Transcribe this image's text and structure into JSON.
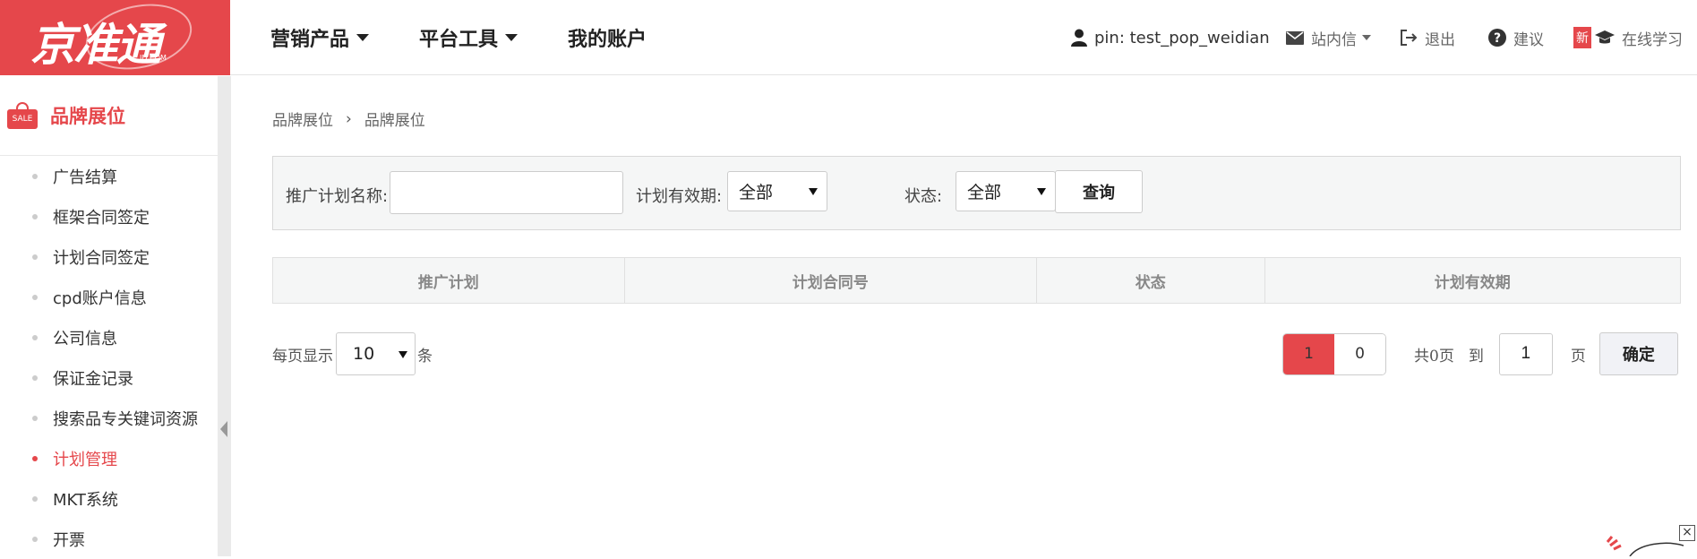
{
  "logo": {
    "text": "京准通",
    "sub": "JD.COM"
  },
  "topnav": [
    {
      "label": "营销产品",
      "dropdown": true
    },
    {
      "label": "平台工具",
      "dropdown": true
    },
    {
      "label": "我的账户",
      "dropdown": false
    }
  ],
  "toolbar": {
    "user": "pin: test_pop_weidian",
    "messages": "站内信",
    "logout": "退出",
    "suggest": "建议",
    "new_badge": "新",
    "learn": "在线学习"
  },
  "sidebar": {
    "title": "品牌展位",
    "sale_tag": "SALE",
    "items": [
      {
        "label": "广告结算",
        "active": false
      },
      {
        "label": "框架合同签定",
        "active": false
      },
      {
        "label": "计划合同签定",
        "active": false
      },
      {
        "label": "cpd账户信息",
        "active": false
      },
      {
        "label": "公司信息",
        "active": false
      },
      {
        "label": "保证金记录",
        "active": false
      },
      {
        "label": "搜索品专关键词资源",
        "active": false
      },
      {
        "label": "计划管理",
        "active": true
      },
      {
        "label": "MKT系统",
        "active": false
      },
      {
        "label": "开票",
        "active": false
      }
    ]
  },
  "breadcrumb": {
    "level1": "品牌展位",
    "separator": "›",
    "level2": "品牌展位"
  },
  "filter": {
    "plan_name_label": "推广计划名称:",
    "plan_name_value": "",
    "validity_label": "计划有效期:",
    "validity_value": "全部",
    "status_label": "状态:",
    "status_value": "全部",
    "query_label": "查询"
  },
  "table": {
    "columns": [
      "推广计划",
      "计划合同号",
      "状态",
      "计划有效期"
    ]
  },
  "pagination": {
    "per_page_prefix": "每页显示",
    "per_page_value": "10",
    "per_page_suffix": "条",
    "pages": [
      "1",
      "0"
    ],
    "current_page": "1",
    "total_text": "共0页",
    "goto_label": "到",
    "goto_value": "1",
    "page_unit": "页",
    "confirm_label": "确定"
  },
  "corner": {
    "close_label": "×"
  },
  "colors": {
    "brand_red": "#e5474b",
    "panel_gray": "#f5f6f6"
  }
}
